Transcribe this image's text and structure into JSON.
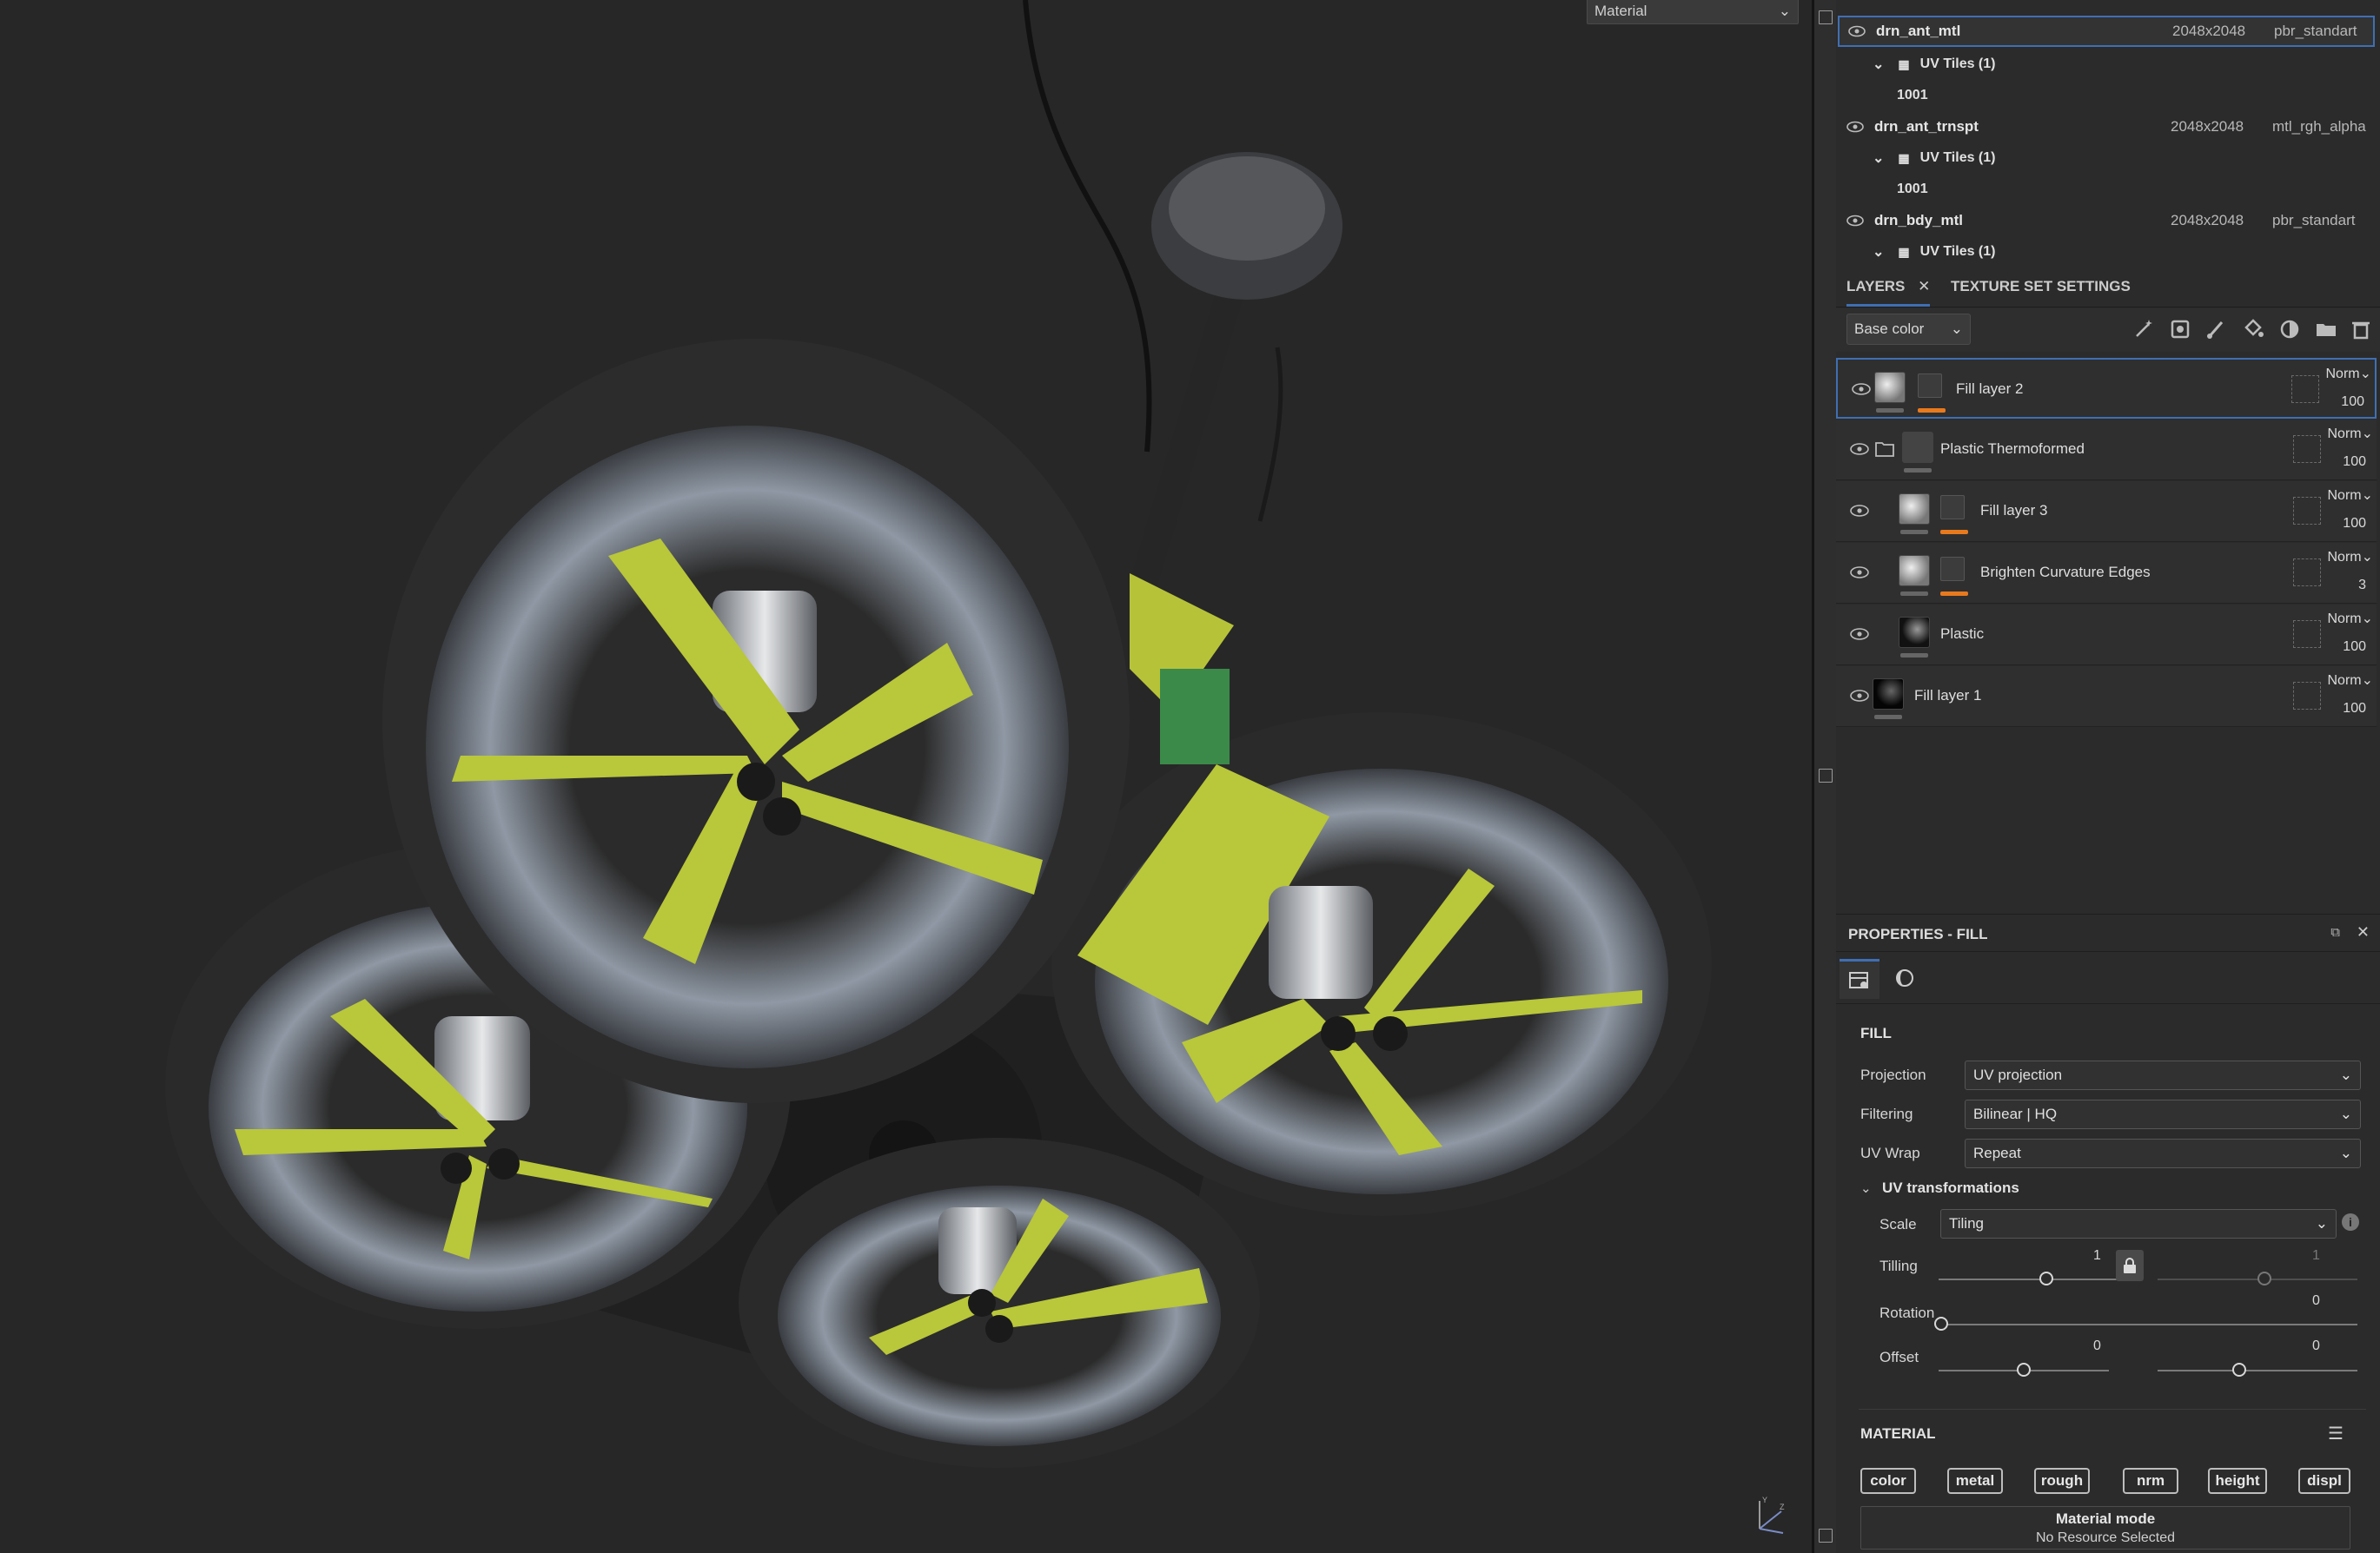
{
  "viewport": {
    "display_select": "Material"
  },
  "texture_sets": [
    {
      "name": "drn_ant_mtl",
      "resolution": "2048x2048",
      "shader": "pbr_standart",
      "selected": true,
      "uv_tiles": "UV Tiles (1)",
      "tile": "1001"
    },
    {
      "name": "drn_ant_trnspt",
      "resolution": "2048x2048",
      "shader": "mtl_rgh_alpha",
      "uv_tiles": "UV Tiles (1)",
      "tile": "1001"
    },
    {
      "name": "drn_bdy_mtl",
      "resolution": "2048x2048",
      "shader": "pbr_standart",
      "uv_tiles": "UV Tiles (1)"
    }
  ],
  "tabs": {
    "layers": "LAYERS",
    "texture_set_settings": "TEXTURE SET SETTINGS"
  },
  "layers_toolbar": {
    "channel": "Base color"
  },
  "layers": [
    {
      "name": "Fill layer 2",
      "blend": "Norm",
      "opacity": "100"
    },
    {
      "name": "Plastic Thermoformed",
      "blend": "Norm",
      "opacity": "100"
    },
    {
      "name": "Fill layer 3",
      "blend": "Norm",
      "opacity": "100"
    },
    {
      "name": "Brighten Curvature Edges",
      "blend": "Norm",
      "opacity": "3"
    },
    {
      "name": "Plastic",
      "blend": "Norm",
      "opacity": "100"
    },
    {
      "name": "Fill layer 1",
      "blend": "Norm",
      "opacity": "100"
    }
  ],
  "properties": {
    "title": "PROPERTIES - FILL",
    "fill_section": "FILL",
    "projection_label": "Projection",
    "projection_value": "UV projection",
    "filtering_label": "Filtering",
    "filtering_value": "Bilinear | HQ",
    "uvwrap_label": "UV Wrap",
    "uvwrap_value": "Repeat",
    "uvtrans_section": "UV transformations",
    "scale_label": "Scale",
    "scale_value": "Tiling",
    "tiling_label": "Tilling",
    "tiling_value_1": "1",
    "tiling_value_2": "1",
    "rotation_label": "Rotation",
    "rotation_value": "0",
    "offset_label": "Offset",
    "offset_value_1": "0",
    "offset_value_2": "0",
    "material_section": "MATERIAL",
    "channels": [
      "color",
      "metal",
      "rough",
      "nrm",
      "height",
      "displ"
    ],
    "material_mode_title": "Material mode",
    "material_mode_sub": "No Resource Selected"
  },
  "colors": {
    "accent": "#3f6fb3",
    "mask_orange": "#e87a1e",
    "prop_yellow": "#b9c73a"
  }
}
